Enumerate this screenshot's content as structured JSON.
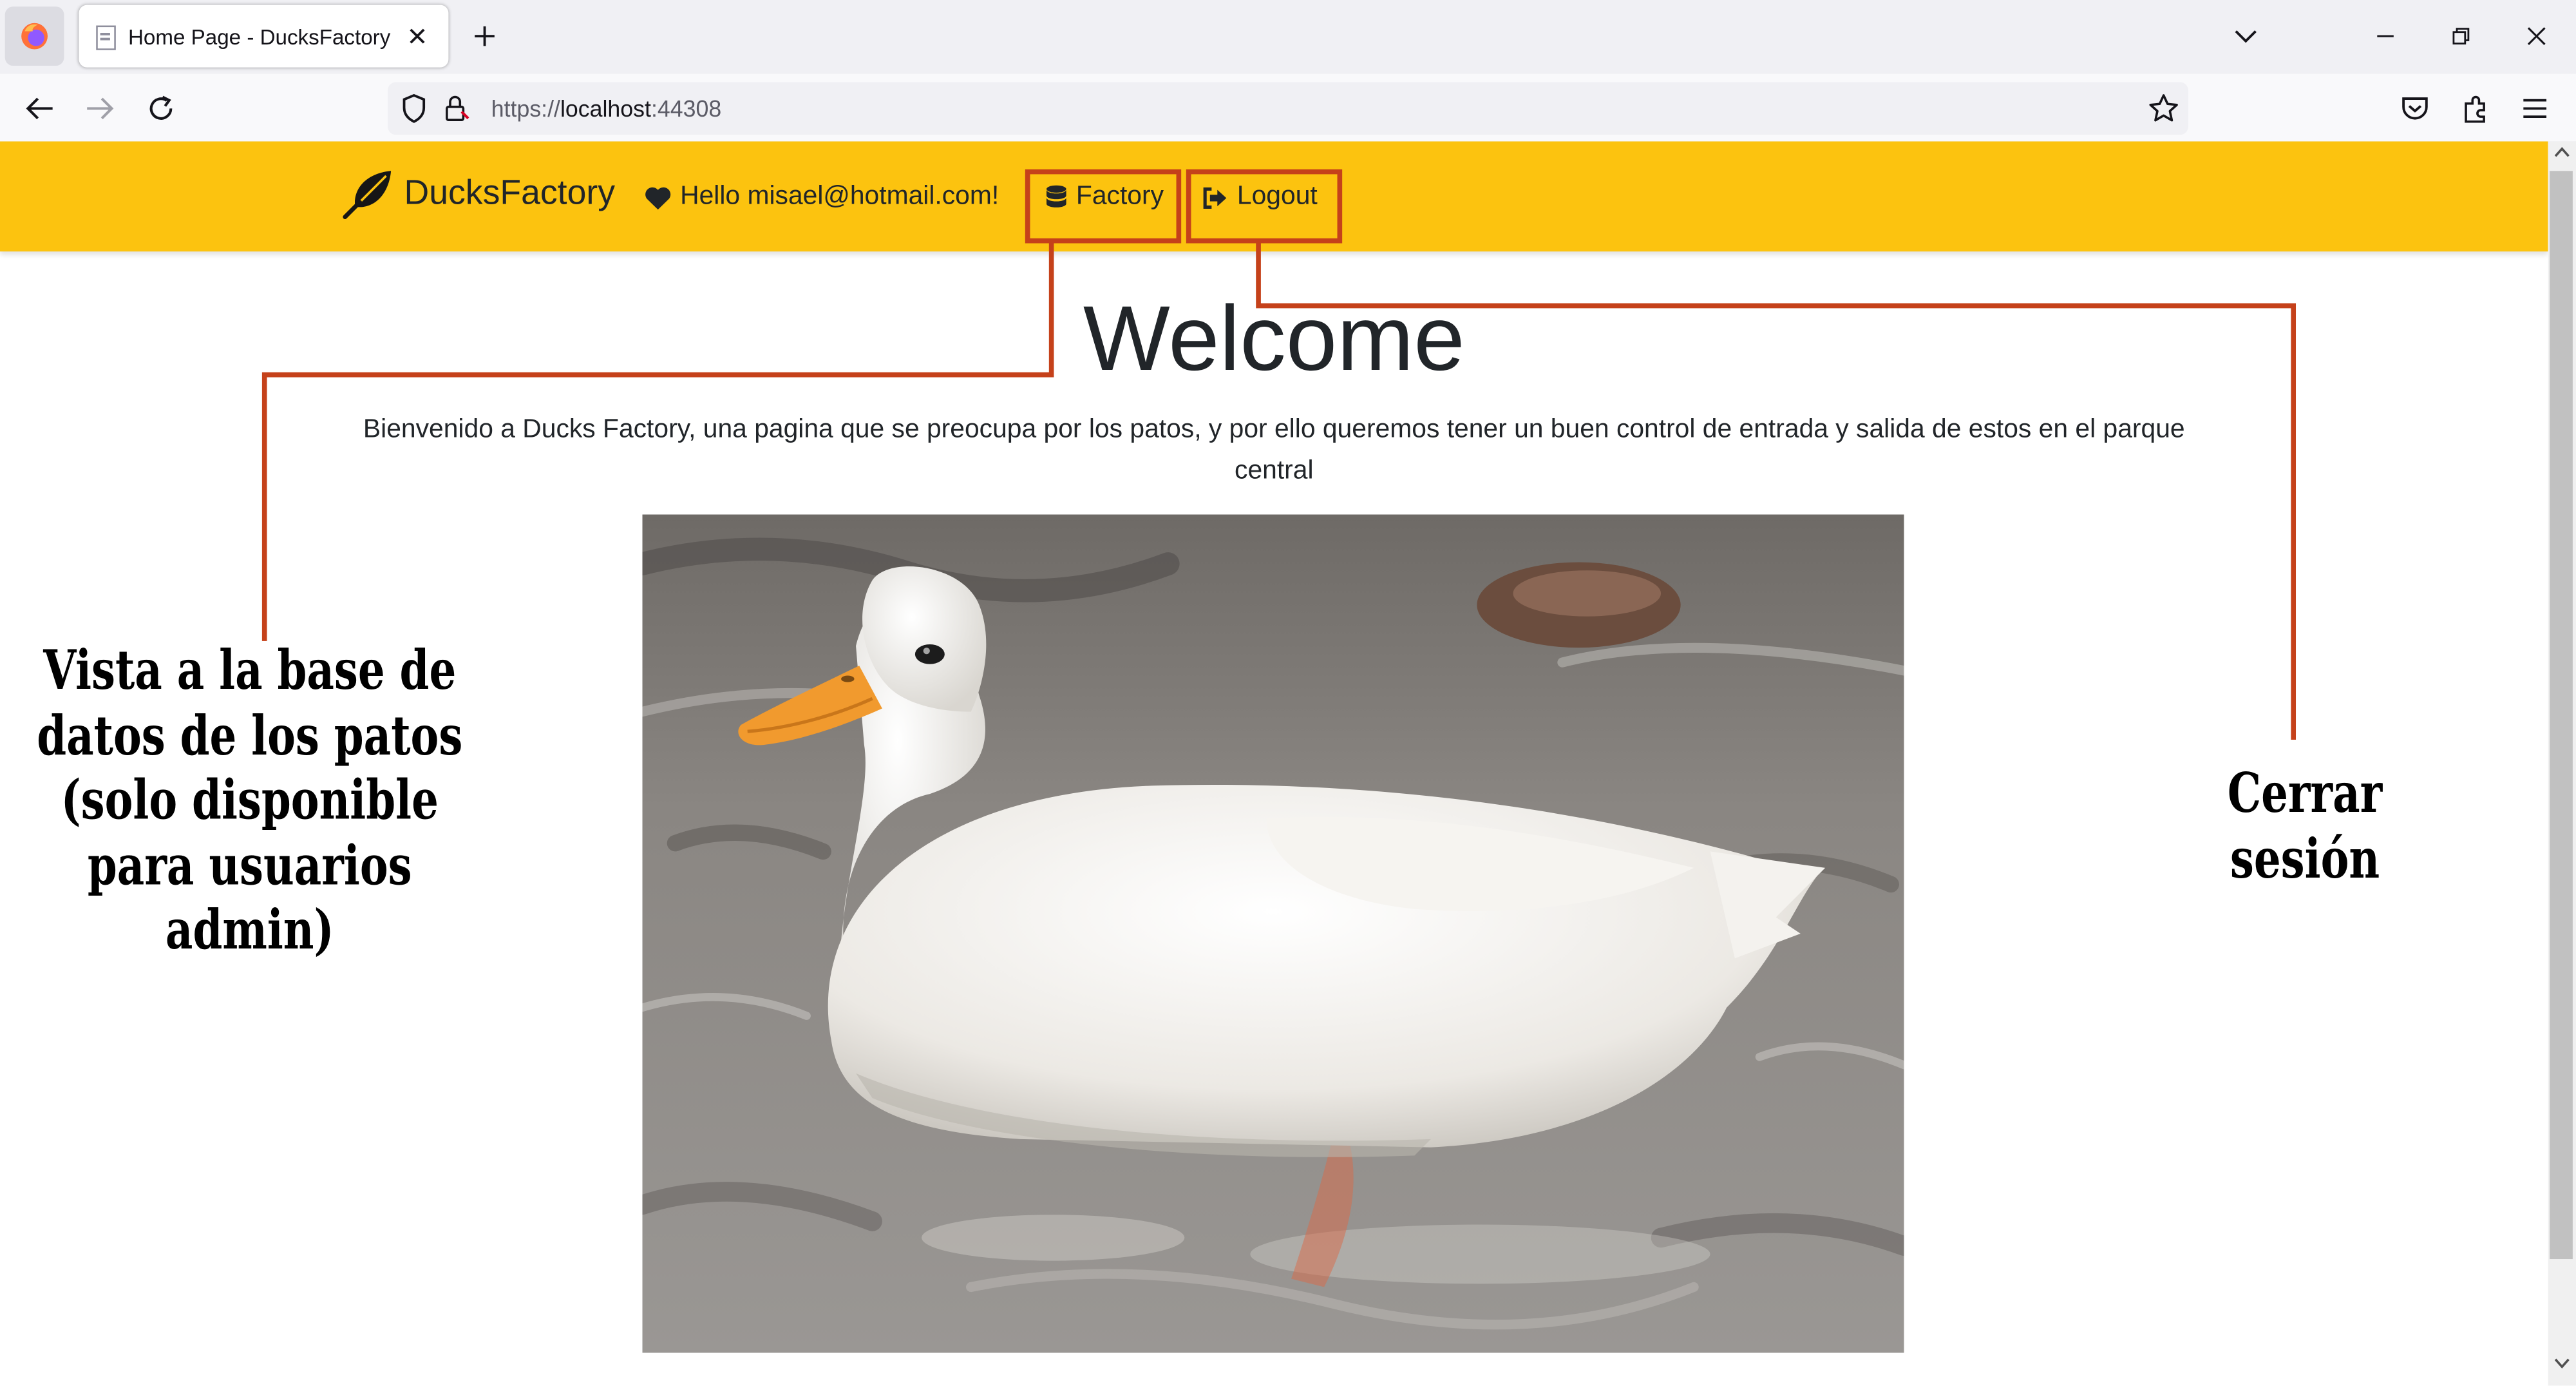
{
  "browser": {
    "tab_title": "Home Page - DucksFactory",
    "url_scheme": "https://",
    "url_host": "localhost",
    "url_port": ":44308"
  },
  "site": {
    "brand": "DucksFactory",
    "greeting": "Hello misael@hotmail.com!",
    "nav_factory": "Factory",
    "nav_logout": "Logout",
    "welcome_title": "Welcome",
    "intro_text": "Bienvenido a Ducks Factory, una pagina que se preocupa por los patos, y por ello queremos tener un buen control de entrada y salida de estos en el parque central",
    "accent_color": "#fcc30f"
  },
  "annotations": {
    "factory_note": "Vista a la base de datos de los patos (solo disponible para usuarios admin)",
    "logout_note": "Cerrar sesión",
    "line_color": "#c5411a"
  }
}
